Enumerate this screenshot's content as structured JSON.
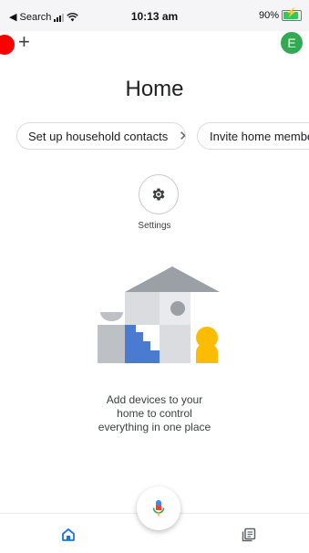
{
  "status_bar": {
    "back_app": "◀ Search",
    "time": "10:13 am",
    "battery": "90%"
  },
  "header": {
    "add_symbol": "+",
    "avatar_initial": "E",
    "title": "Home"
  },
  "chips": [
    {
      "label": "Set up household contacts",
      "close": "✕"
    },
    {
      "label": "Invite home member"
    }
  ],
  "settings": {
    "label": "Settings",
    "icon": "gear-icon"
  },
  "empty_state": {
    "lines": [
      "Add devices to your",
      "home to control",
      "everything in one place"
    ]
  },
  "nav": {
    "home_icon": "home-icon",
    "mic_icon": "mic-icon",
    "feed_icon": "feed-icon"
  },
  "colors": {
    "avatar": "#34a853",
    "record_dot": "#ff0000",
    "accent_blue": "#1a73e8",
    "illustration_blue": "#4a7bd0",
    "illustration_yellow": "#fbbc04"
  }
}
